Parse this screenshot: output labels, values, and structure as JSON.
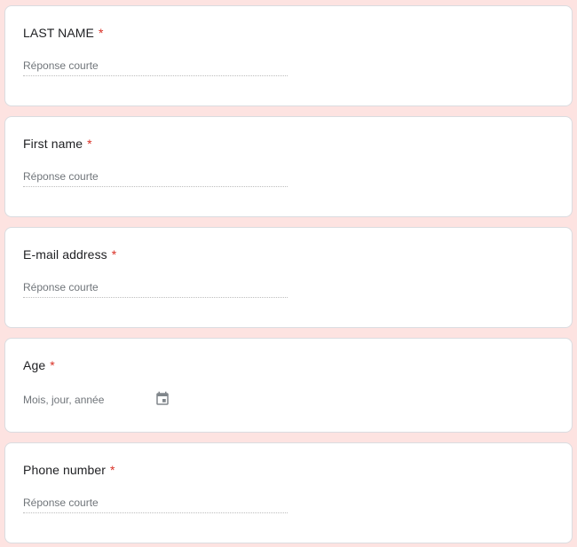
{
  "form": {
    "questions": [
      {
        "id": "last-name",
        "title": "LAST NAME",
        "required_mark": "*",
        "placeholder": "Réponse courte",
        "type": "short-answer"
      },
      {
        "id": "first-name",
        "title": "First name",
        "required_mark": "*",
        "placeholder": "Réponse courte",
        "type": "short-answer"
      },
      {
        "id": "email",
        "title": "E-mail address",
        "required_mark": "*",
        "placeholder": "Réponse courte",
        "type": "short-answer"
      },
      {
        "id": "age",
        "title": "Age",
        "required_mark": "*",
        "placeholder": "Mois, jour, année",
        "type": "date",
        "icon": "calendar-icon"
      },
      {
        "id": "phone",
        "title": "Phone number",
        "required_mark": "*",
        "placeholder": "Réponse courte",
        "type": "short-answer"
      }
    ]
  },
  "colors": {
    "page_background": "#fde3e1",
    "card_background": "#ffffff",
    "card_border": "#dadce0",
    "required_mark": "#d93025",
    "title_text": "#202124",
    "placeholder_text": "#70757a"
  }
}
